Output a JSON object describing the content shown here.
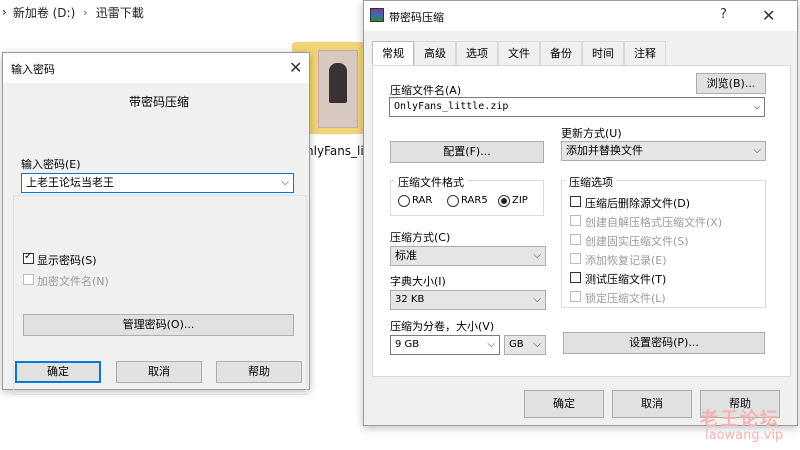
{
  "explorer": {
    "breadcrumb": [
      "新加卷 (D:)",
      "迅雷下載"
    ],
    "breadcrumb_sep": "›",
    "file_label": "nlyFans_lit"
  },
  "password_dialog": {
    "title": "输入密码",
    "heading": "带密码压缩",
    "input_label": "输入密码(E)",
    "input_value": "上老王论坛当老王",
    "show_password": "显示密码(S)",
    "encrypt_names": "加密文件名(N)",
    "manage_button": "管理密码(O)...",
    "ok": "确定",
    "cancel": "取消",
    "help": "帮助"
  },
  "compress_dialog": {
    "title": "带密码压缩",
    "help_glyph": "?",
    "tabs": [
      "常规",
      "高级",
      "选项",
      "文件",
      "备份",
      "时间",
      "注释"
    ],
    "archive_name_label": "压缩文件名(A)",
    "browse_button": "浏览(B)...",
    "archive_name_value": "OnlyFans_little.zip",
    "profiles_button": "配置(F)...",
    "update_mode_label": "更新方式(U)",
    "update_mode_value": "添加并替换文件",
    "format_group": "压缩文件格式",
    "formats": [
      "RAR",
      "RAR5",
      "ZIP"
    ],
    "selected_format": "ZIP",
    "method_label": "压缩方式(C)",
    "method_value": "标准",
    "dict_label": "字典大小(I)",
    "dict_value": "32 KB",
    "split_label": "压缩为分卷，大小(V)",
    "split_value": "9 GB",
    "split_unit": "GB",
    "options_group": "压缩选项",
    "options": [
      {
        "label": "压缩后删除源文件(D)",
        "enabled": true,
        "checked": false
      },
      {
        "label": "创建自解压格式压缩文件(X)",
        "enabled": false,
        "checked": false
      },
      {
        "label": "创建固实压缩文件(S)",
        "enabled": false,
        "checked": false
      },
      {
        "label": "添加恢复记录(E)",
        "enabled": false,
        "checked": false
      },
      {
        "label": "测试压缩文件(T)",
        "enabled": true,
        "checked": false
      },
      {
        "label": "锁定压缩文件(L)",
        "enabled": false,
        "checked": false
      }
    ],
    "set_password_button": "设置密码(P)...",
    "ok": "确定",
    "cancel": "取消",
    "help": "帮助"
  },
  "watermark": {
    "line1": "老王论坛",
    "line2": "laowang.vip"
  }
}
